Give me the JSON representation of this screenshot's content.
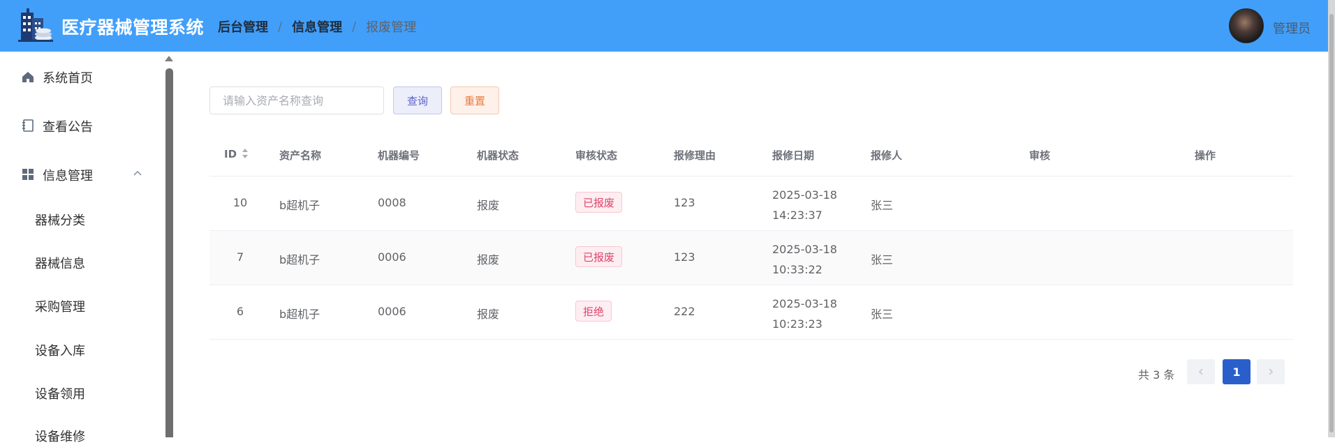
{
  "header": {
    "app_title": "医疗器械管理系统",
    "breadcrumb": [
      "后台管理",
      "信息管理",
      "报废管理"
    ],
    "separator": "/",
    "user_name": "管理员",
    "bg_color": "#419ffa"
  },
  "sidebar": {
    "items": [
      {
        "label": "系统首页",
        "icon": "home-icon"
      },
      {
        "label": "查看公告",
        "icon": "notebook-icon"
      },
      {
        "label": "信息管理",
        "icon": "grid-icon",
        "expanded": true
      }
    ],
    "sub_items": [
      "器械分类",
      "器械信息",
      "采购管理",
      "设备入库",
      "设备领用",
      "设备维修"
    ]
  },
  "toolbar": {
    "search_placeholder": "请输入资产名称查询",
    "search_value": "",
    "query_label": "查询",
    "reset_label": "重置"
  },
  "table": {
    "columns": [
      "ID",
      "资产名称",
      "机器编号",
      "机器状态",
      "审核状态",
      "报修理由",
      "报修日期",
      "报修人",
      "审核",
      "操作"
    ],
    "rows": [
      {
        "id": "10",
        "asset": "b超机子",
        "machine_no": "0008",
        "machine_status": "报废",
        "review_status": "已报废",
        "reason": "123",
        "date": "2025-03-18 14:23:37",
        "reporter": "张三"
      },
      {
        "id": "7",
        "asset": "b超机子",
        "machine_no": "0006",
        "machine_status": "报废",
        "review_status": "已报废",
        "reason": "123",
        "date": "2025-03-18 10:33:22",
        "reporter": "张三"
      },
      {
        "id": "6",
        "asset": "b超机子",
        "machine_no": "0006",
        "machine_status": "报废",
        "review_status": "拒绝",
        "reason": "222",
        "date": "2025-03-18 10:23:23",
        "reporter": "张三"
      }
    ]
  },
  "pagination": {
    "total_text": "共 3 条",
    "current_page": "1"
  }
}
